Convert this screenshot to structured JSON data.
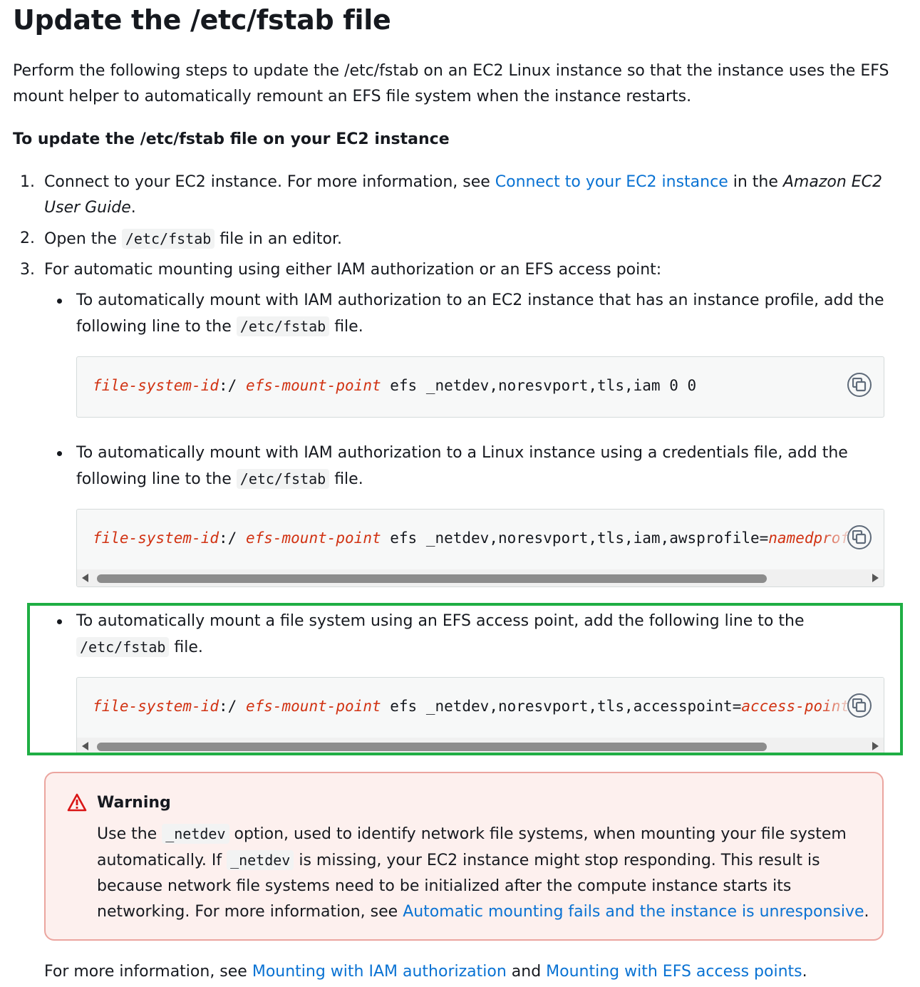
{
  "title": "Update the /etc/fstab file",
  "intro": "Perform the following steps to update the /etc/fstab on an EC2 Linux instance so that the instance uses the EFS mount helper to automatically remount an EFS file system when the instance restarts.",
  "intro_line1": "Perform the following steps to update the /etc/fstab on an EC2 Linux instance so that the instance uses the EFS",
  "intro_line2": "mount helper to automatically remount an EFS file system when the instance restarts.",
  "procedure_title": "To update the /etc/fstab file on your EC2 instance",
  "steps": {
    "s1": {
      "num": "1.",
      "pre": "Connect to your EC2 instance. For more information, see ",
      "link": "Connect to your EC2 instance",
      "mid": " in the ",
      "guide1": "Amazon EC2",
      "guide2": "User Guide",
      "end": "."
    },
    "s2": {
      "num": "2.",
      "pre": "Open the ",
      "code": "/etc/fstab",
      "post": " file in an editor."
    },
    "s3": {
      "num": "3.",
      "text": "For automatic mounting using either IAM authorization or an EFS access point:"
    }
  },
  "bullets": {
    "b1": {
      "line1": "To automatically mount with IAM authorization to an EC2 instance that has an instance profile, add the",
      "pre2": "following line to the ",
      "code": "/etc/fstab",
      "post2": " file."
    },
    "b2": {
      "line1": "To automatically mount with IAM authorization to a Linux instance using a credentials file, add the",
      "pre2": "following line to the ",
      "code": "/etc/fstab",
      "post2": " file."
    },
    "b3": {
      "line1": "To automatically mount a file system using an EFS access point, add the following line to the",
      "code": "/etc/fstab",
      "post2": " file."
    }
  },
  "code": {
    "c1": {
      "fsid": "file-system-id",
      "sep": ":/ ",
      "mp": "efs-mount-point",
      "rest": " efs _netdev,noresvport,tls,iam 0 0"
    },
    "c2": {
      "fsid": "file-system-id",
      "sep": ":/ ",
      "mp": "efs-mount-point",
      "rest": " efs _netdev,noresvport,tls,iam,awsprofile=",
      "tail": "namedprofile"
    },
    "c3": {
      "fsid": "file-system-id",
      "sep": ":/ ",
      "mp": "efs-mount-point",
      "rest": " efs _netdev,noresvport,tls,accesspoint=",
      "tail": "access-point-id"
    }
  },
  "warning": {
    "title": "Warning",
    "l1_pre": "Use the ",
    "l1_code": "_netdev",
    "l1_post": " option, used to identify network file systems, when mounting your file system",
    "l2_pre": "automatically. If ",
    "l2_code": "_netdev",
    "l2_post": " is missing, your EC2 instance might stop responding. This result is",
    "l3": "because network file systems need to be initialized after the compute instance starts its",
    "l4_pre": "networking. For more information, see ",
    "l4_link": "Automatic mounting fails and the instance is unresponsive",
    "l4_post": "."
  },
  "footer": {
    "pre": "For more information, see ",
    "link1": "Mounting with IAM authorization",
    "mid": " and ",
    "link2": "Mounting with EFS access points",
    "post": "."
  },
  "colors": {
    "link": "#0972d3",
    "replaceable": "#d13212",
    "highlight": "#1fae44",
    "warning_border": "#eba59f",
    "warning_bg": "#fdf0ee",
    "warning_icon": "#d91515"
  },
  "icons": {
    "copy": "copy-icon",
    "warning": "warning-triangle-icon"
  }
}
